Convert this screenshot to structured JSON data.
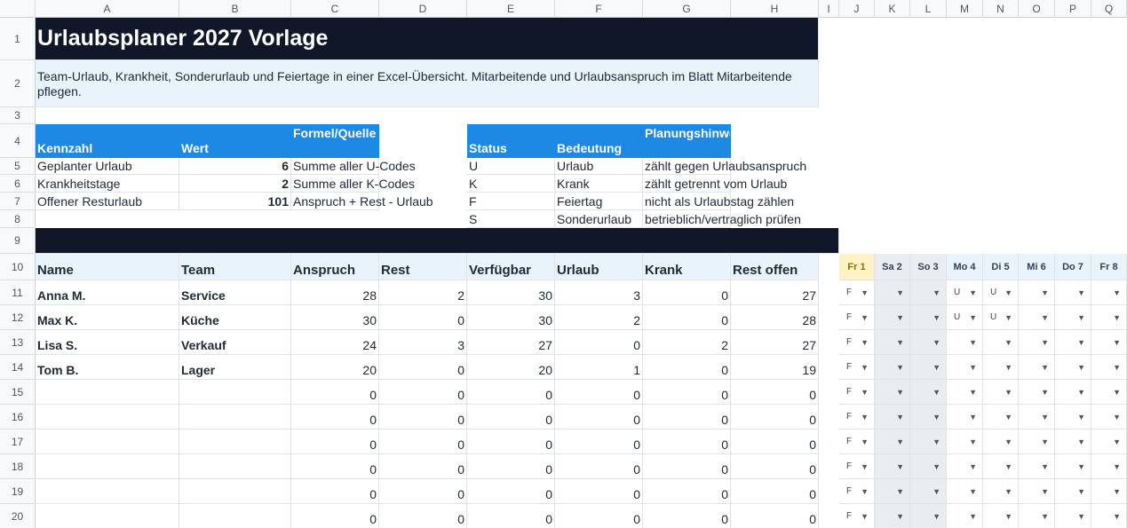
{
  "columns": [
    "A",
    "B",
    "C",
    "D",
    "E",
    "F",
    "G",
    "H",
    "I",
    "J",
    "K",
    "L",
    "M",
    "N",
    "O",
    "P",
    "Q"
  ],
  "rows": [
    "1",
    "2",
    "3",
    "4",
    "5",
    "6",
    "7",
    "8",
    "9",
    "10",
    "11",
    "12",
    "13",
    "14",
    "15",
    "16",
    "17",
    "18",
    "19",
    "20"
  ],
  "title": "Urlaubsplaner 2027 Vorlage",
  "subtitle": "Team-Urlaub, Krankheit, Sonderurlaub und Feiertage in einer Excel-Übersicht. Mitarbeitende und Urlaubsanspruch im Blatt Mitarbeitende pflegen.",
  "kpi": {
    "headers": [
      "Kennzahl",
      "Wert",
      "Formel/Quelle"
    ],
    "rows": [
      {
        "name": "Geplanter Urlaub",
        "value": "6",
        "source": "Summe aller U-Codes"
      },
      {
        "name": "Krankheitstage",
        "value": "2",
        "source": "Summe aller K-Codes"
      },
      {
        "name": "Offener Resturlaub",
        "value": "101",
        "source": "Anspruch + Rest - Urlaub"
      }
    ]
  },
  "legend": {
    "headers": [
      "Status",
      "Bedeutung",
      "Planungshinweis"
    ],
    "rows": [
      {
        "code": "U",
        "meaning": "Urlaub",
        "hint": "zählt gegen Urlaubsanspruch"
      },
      {
        "code": "K",
        "meaning": "Krank",
        "hint": "zählt getrennt vom Urlaub"
      },
      {
        "code": "F",
        "meaning": "Feiertag",
        "hint": "nicht als Urlaubstag zählen"
      },
      {
        "code": "S",
        "meaning": "Sonderurlaub",
        "hint": "betrieblich/vertraglich prüfen"
      }
    ]
  },
  "table": {
    "headers": [
      "Name",
      "Team",
      "Anspruch",
      "Rest",
      "Verfügbar",
      "Urlaub",
      "Krank",
      "Rest offen"
    ],
    "rows": [
      [
        "Anna M.",
        "Service",
        "28",
        "2",
        "30",
        "3",
        "0",
        "27"
      ],
      [
        "Max K.",
        "Küche",
        "30",
        "0",
        "30",
        "2",
        "0",
        "28"
      ],
      [
        "Lisa S.",
        "Verkauf",
        "24",
        "3",
        "27",
        "0",
        "2",
        "27"
      ],
      [
        "Tom B.",
        "Lager",
        "20",
        "0",
        "20",
        "1",
        "0",
        "19"
      ],
      [
        "",
        "",
        "0",
        "0",
        "0",
        "0",
        "0",
        "0"
      ],
      [
        "",
        "",
        "0",
        "0",
        "0",
        "0",
        "0",
        "0"
      ],
      [
        "",
        "",
        "0",
        "0",
        "0",
        "0",
        "0",
        "0"
      ],
      [
        "",
        "",
        "0",
        "0",
        "0",
        "0",
        "0",
        "0"
      ],
      [
        "",
        "",
        "0",
        "0",
        "0",
        "0",
        "0",
        "0"
      ],
      [
        "",
        "",
        "0",
        "0",
        "0",
        "0",
        "0",
        "0"
      ]
    ]
  },
  "calendar": {
    "days": [
      "Fr 1",
      "Sa 2",
      "So 3",
      "Mo 4",
      "Di 5",
      "Mi 6",
      "Do 7",
      "Fr 8"
    ],
    "weekend": [
      false,
      true,
      true,
      false,
      false,
      false,
      false,
      false
    ],
    "highlight": [
      true,
      false,
      false,
      false,
      false,
      false,
      false,
      false
    ],
    "entries": [
      [
        "F",
        "",
        "",
        "U",
        "U",
        "",
        "",
        ""
      ],
      [
        "F",
        "",
        "",
        "U",
        "U",
        "",
        "",
        ""
      ],
      [
        "F",
        "",
        "",
        "",
        "",
        "",
        "",
        ""
      ],
      [
        "F",
        "",
        "",
        "",
        "",
        "",
        "",
        ""
      ],
      [
        "F",
        "",
        "",
        "",
        "",
        "",
        "",
        ""
      ],
      [
        "F",
        "",
        "",
        "",
        "",
        "",
        "",
        ""
      ],
      [
        "F",
        "",
        "",
        "",
        "",
        "",
        "",
        ""
      ],
      [
        "F",
        "",
        "",
        "",
        "",
        "",
        "",
        ""
      ],
      [
        "F",
        "",
        "",
        "",
        "",
        "",
        "",
        ""
      ],
      [
        "F",
        "",
        "",
        "",
        "",
        "",
        "",
        ""
      ]
    ]
  },
  "colors": {
    "dark": "#0f1729",
    "blue": "#1e88e5",
    "light": "#e8f3fc",
    "today": "#fff2c4"
  },
  "icons": {
    "dropdown": "dropdown-arrow-icon"
  }
}
